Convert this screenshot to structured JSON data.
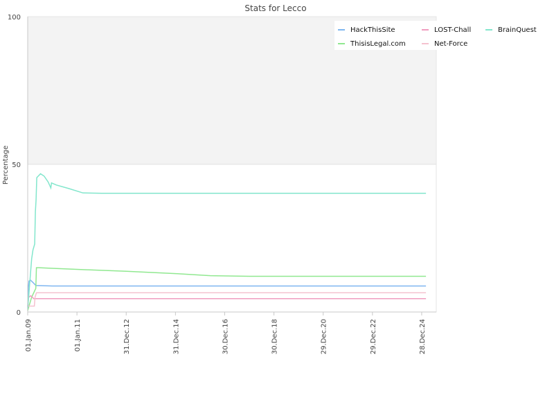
{
  "chart_data": {
    "type": "line",
    "title": "Stats for Lecco",
    "ylabel": "Percentage",
    "xlabel": "",
    "ylim": [
      0,
      100
    ],
    "yticks": [
      0,
      50,
      100
    ],
    "xlim": [
      "2009-01-01",
      "2025-08-01"
    ],
    "xticks": [
      {
        "date": "2009-01-01",
        "label": "01.Jan.09"
      },
      {
        "date": "2011-01-01",
        "label": "01.Jan.11"
      },
      {
        "date": "2012-12-31",
        "label": "31.Dec.12"
      },
      {
        "date": "2014-12-31",
        "label": "31.Dec.14"
      },
      {
        "date": "2016-12-30",
        "label": "30.Dec.16"
      },
      {
        "date": "2018-12-30",
        "label": "30.Dec.18"
      },
      {
        "date": "2020-12-29",
        "label": "29.Dec.20"
      },
      {
        "date": "2022-12-29",
        "label": "29.Dec.22"
      },
      {
        "date": "2024-12-28",
        "label": "28.Dec.24"
      }
    ],
    "bands": [
      {
        "from": 50,
        "to": 100,
        "color": "#f3f3f3"
      }
    ],
    "legend_position": "top-right",
    "grid": false,
    "series": [
      {
        "name": "HackThisSite",
        "color": "#7eb6f0",
        "points": [
          [
            "2009-01-01",
            1.5
          ],
          [
            "2009-01-10",
            8.0
          ],
          [
            "2009-01-20",
            10.5
          ],
          [
            "2009-02-10",
            10.8
          ],
          [
            "2009-03-20",
            10.0
          ],
          [
            "2009-05-01",
            9.0
          ],
          [
            "2010-01-01",
            8.8
          ],
          [
            "2012-01-01",
            8.8
          ],
          [
            "2016-01-01",
            8.8
          ],
          [
            "2020-01-01",
            8.8
          ],
          [
            "2025-03-01",
            8.8
          ]
        ]
      },
      {
        "name": "ThisisLegal.com",
        "color": "#90e890",
        "points": [
          [
            "2009-01-01",
            0.5
          ],
          [
            "2009-01-20",
            2.0
          ],
          [
            "2009-03-01",
            5.0
          ],
          [
            "2009-05-01",
            8.0
          ],
          [
            "2009-05-10",
            15.0
          ],
          [
            "2009-06-15",
            15.0
          ],
          [
            "2010-01-01",
            14.8
          ],
          [
            "2011-06-01",
            14.3
          ],
          [
            "2013-01-01",
            13.8
          ],
          [
            "2015-01-01",
            13.0
          ],
          [
            "2016-06-01",
            12.3
          ],
          [
            "2018-01-01",
            12.1
          ],
          [
            "2025-03-01",
            12.1
          ]
        ]
      },
      {
        "name": "LOST-Chall",
        "color": "#f09cbf",
        "points": [
          [
            "2009-01-01",
            2.0
          ],
          [
            "2009-01-15",
            5.0
          ],
          [
            "2009-02-15",
            5.5
          ],
          [
            "2009-04-01",
            4.5
          ],
          [
            "2010-01-01",
            4.5
          ],
          [
            "2016-01-01",
            4.5
          ],
          [
            "2025-03-01",
            4.5
          ]
        ]
      },
      {
        "name": "Net-Force",
        "color": "#f5c2cf",
        "points": [
          [
            "2009-01-01",
            3.0
          ],
          [
            "2009-01-15",
            2.0
          ],
          [
            "2009-04-10",
            2.0
          ],
          [
            "2009-04-20",
            5.0
          ],
          [
            "2009-05-10",
            6.5
          ],
          [
            "2010-01-01",
            6.5
          ],
          [
            "2016-01-01",
            6.5
          ],
          [
            "2025-03-01",
            6.5
          ]
        ]
      },
      {
        "name": "BrainQuest",
        "color": "#82e6cc",
        "points": [
          [
            "2009-01-01",
            1.0
          ],
          [
            "2009-01-15",
            5.0
          ],
          [
            "2009-02-01",
            10.0
          ],
          [
            "2009-03-01",
            18.0
          ],
          [
            "2009-03-20",
            21.0
          ],
          [
            "2009-04-15",
            23.0
          ],
          [
            "2009-04-25",
            34.0
          ],
          [
            "2009-05-05",
            38.0
          ],
          [
            "2009-05-15",
            45.5
          ],
          [
            "2009-07-10",
            46.8
          ],
          [
            "2009-09-01",
            46.0
          ],
          [
            "2009-11-01",
            44.0
          ],
          [
            "2009-12-10",
            42.0
          ],
          [
            "2009-12-20",
            43.7
          ],
          [
            "2010-03-01",
            43.0
          ],
          [
            "2010-09-01",
            41.8
          ],
          [
            "2011-04-01",
            40.3
          ],
          [
            "2012-01-01",
            40.2
          ],
          [
            "2016-01-01",
            40.2
          ],
          [
            "2025-03-01",
            40.2
          ]
        ]
      }
    ]
  }
}
